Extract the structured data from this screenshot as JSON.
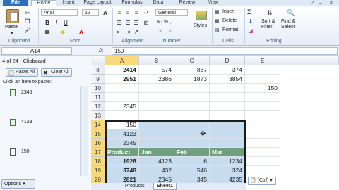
{
  "ribbon_tabs": [
    "File",
    "Home",
    "Insert",
    "Page Layout",
    "Formulas",
    "Data",
    "Review",
    "View"
  ],
  "window_controls": [
    "?",
    "–",
    "✕"
  ],
  "ribbon": {
    "paste_label": "Paste",
    "clipboard_group": "Clipboard",
    "font_name": "Arial",
    "font_size": "12",
    "font_group": "Font",
    "alignment_group": "Alignment",
    "number_format": "General",
    "number_symbol": "$ - % ,",
    "number_group": "Number",
    "styles_label": "Styles",
    "insert_label": "Insert",
    "delete_label": "Delete",
    "format_label": "Format",
    "cells_group": "Cells",
    "sum_symbol": "Σ",
    "sort_label": "Sort &",
    "filter_label": "Filter",
    "find_label": "Find &",
    "select_label": "Select",
    "editing_group": "Editing",
    "bold": "B",
    "italic": "I",
    "underline": "U"
  },
  "formula_bar": {
    "name_box": "A14",
    "fx": "fx",
    "content": "150"
  },
  "clipboard_pane": {
    "title": "4 of 24 - Clipboard",
    "paste_all": "Paste All",
    "clear_all": "Clear All",
    "hint": "Click an item to paste:",
    "items": [
      "2345",
      "4123",
      "150"
    ],
    "options": "Options"
  },
  "grid": {
    "columns": [
      "A",
      "B",
      "C",
      "D",
      "E"
    ],
    "rows": [
      {
        "num": "8",
        "cells": [
          "2414",
          "574",
          "837",
          "374",
          ""
        ]
      },
      {
        "num": "9",
        "cells": [
          "2951",
          "2386",
          "1873",
          "3854",
          ""
        ]
      },
      {
        "num": "10",
        "cells": [
          "",
          "",
          "",
          "",
          "150"
        ]
      },
      {
        "num": "11",
        "cells": [
          "",
          "",
          "",
          "",
          ""
        ]
      },
      {
        "num": "12",
        "cells": [
          "2345",
          "",
          "",
          "",
          ""
        ]
      },
      {
        "num": "13",
        "cells": [
          "",
          "",
          "",
          "",
          ""
        ]
      },
      {
        "num": "14",
        "cells": [
          "150",
          "",
          "",
          "",
          ""
        ]
      },
      {
        "num": "15",
        "cells": [
          "4123",
          "",
          "",
          "",
          ""
        ]
      },
      {
        "num": "16",
        "cells": [
          "2345",
          "",
          "",
          "",
          ""
        ]
      },
      {
        "num": "17",
        "cells": [
          "Product",
          "Jan",
          "Feb",
          "Mar",
          ""
        ]
      },
      {
        "num": "18",
        "cells": [
          "1928",
          "4123",
          "6",
          "1234",
          ""
        ]
      },
      {
        "num": "19",
        "cells": [
          "3748",
          "432",
          "546",
          "324",
          ""
        ]
      },
      {
        "num": "20",
        "cells": [
          "2821",
          "2345",
          "345",
          "4235",
          ""
        ]
      }
    ]
  },
  "sheet_tabs": [
    "Products",
    "Sheet1"
  ],
  "paste_options": "(Ctrl)",
  "colors": {
    "accent": "#2a6ebd",
    "header_band": "#6f9f7f",
    "selection_fill": "#c7dcef",
    "selected_header": "#f9d97b"
  }
}
